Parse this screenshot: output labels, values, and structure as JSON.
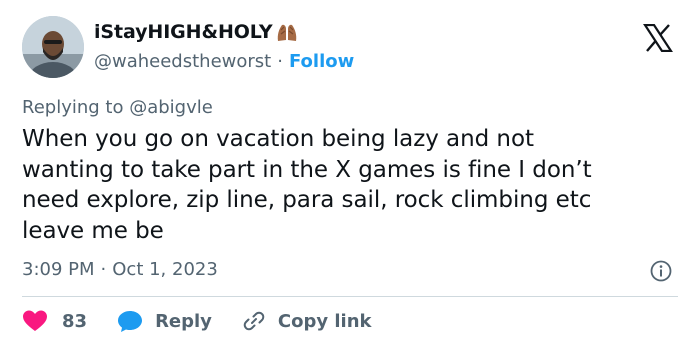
{
  "header": {
    "display_name": "iStayHIGH&HOLY",
    "handle": "@waheedstheworst",
    "separator": "·",
    "follow_label": "Follow"
  },
  "icons": {
    "avatar": "profile-photo",
    "name_emoji": "praying-hands",
    "brand": "x-logo",
    "info": "info-icon",
    "like": "heart-icon",
    "reply": "speech-bubble-icon",
    "copy": "link-icon"
  },
  "replying": {
    "text": "Replying to @abigvle"
  },
  "tweet": {
    "line1": "When you go on vacation being lazy and not",
    "line2": "wanting to take part in the X games is fine I don’t",
    "line3": "need explore, zip line, para sail, rock climbing etc",
    "line4": "leave me be"
  },
  "meta": {
    "time": "3:09 PM",
    "separator": "·",
    "date": "Oct 1, 2023"
  },
  "actions": {
    "likes": "83",
    "reply_label": "Reply",
    "copy_label": "Copy link"
  },
  "colors": {
    "accent": "#1d9bf0",
    "heart": "#f91880",
    "secondary_text": "#536471",
    "primary_text": "#0f1419",
    "divider": "#cfd9de"
  }
}
